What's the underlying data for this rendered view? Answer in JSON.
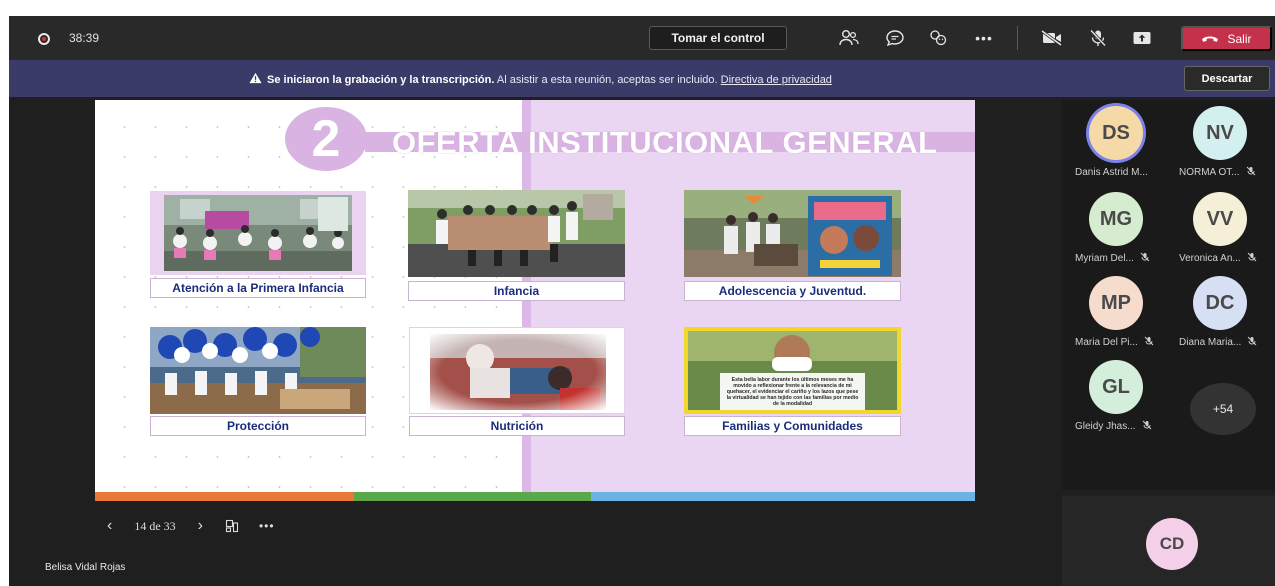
{
  "meeting": {
    "timer": "38:39",
    "take_control_label": "Tomar el control",
    "leave_label": "Salir"
  },
  "banner": {
    "bold_text": "Se iniciaron la grabación y la transcripción.",
    "text": " Al asistir a esta reunión, aceptas ser incluido. ",
    "link_text": "Directiva de privacidad",
    "dismiss_label": "Descartar"
  },
  "slide": {
    "number": "2",
    "title": "OFERTA INSTITUCIONAL GENERAL",
    "cards": [
      {
        "label": "Atención a la Primera Infancia"
      },
      {
        "label": "Infancia"
      },
      {
        "label": "Adolescencia y Juventud."
      },
      {
        "label": "Protección"
      },
      {
        "label": "Nutrición"
      },
      {
        "label": "Familias y Comunidades"
      }
    ],
    "photo_caption_text": "Esta bella labor durante los últimos meses me ha movido a reflexionar frente a la relevancia de mi quehacer, el evidenciar el cariño y los lazos que pese la virtualidad se han tejido con las familias por medio de la modalidad",
    "bottom_colors": [
      "#e8783a",
      "#5aa84a",
      "#6bb3e3"
    ]
  },
  "slide_nav": {
    "counter": "14 de 33"
  },
  "presenter": "Belisa Vidal Rojas",
  "participants": [
    {
      "initials": "DS",
      "name": "Danis Astrid M...",
      "color": "#f5d9a6",
      "muted": false,
      "speaking": true
    },
    {
      "initials": "NV",
      "name": "NORMA OT...",
      "color": "#d4efef",
      "muted": true,
      "speaking": false
    },
    {
      "initials": "MG",
      "name": "Myriam Del...",
      "color": "#d6ecd0",
      "muted": true,
      "speaking": false
    },
    {
      "initials": "VV",
      "name": "Veronica An...",
      "color": "#f4efd6",
      "muted": true,
      "speaking": false
    },
    {
      "initials": "MP",
      "name": "Maria Del Pi...",
      "color": "#f5dccc",
      "muted": true,
      "speaking": false
    },
    {
      "initials": "DC",
      "name": "Diana Maria...",
      "color": "#d7dff4",
      "muted": true,
      "speaking": false
    },
    {
      "initials": "GL",
      "name": "Gleidy Jhas...",
      "color": "#d3eeda",
      "muted": true,
      "speaking": false
    }
  ],
  "overflow_count": "+54",
  "self": {
    "initials": "CD"
  }
}
